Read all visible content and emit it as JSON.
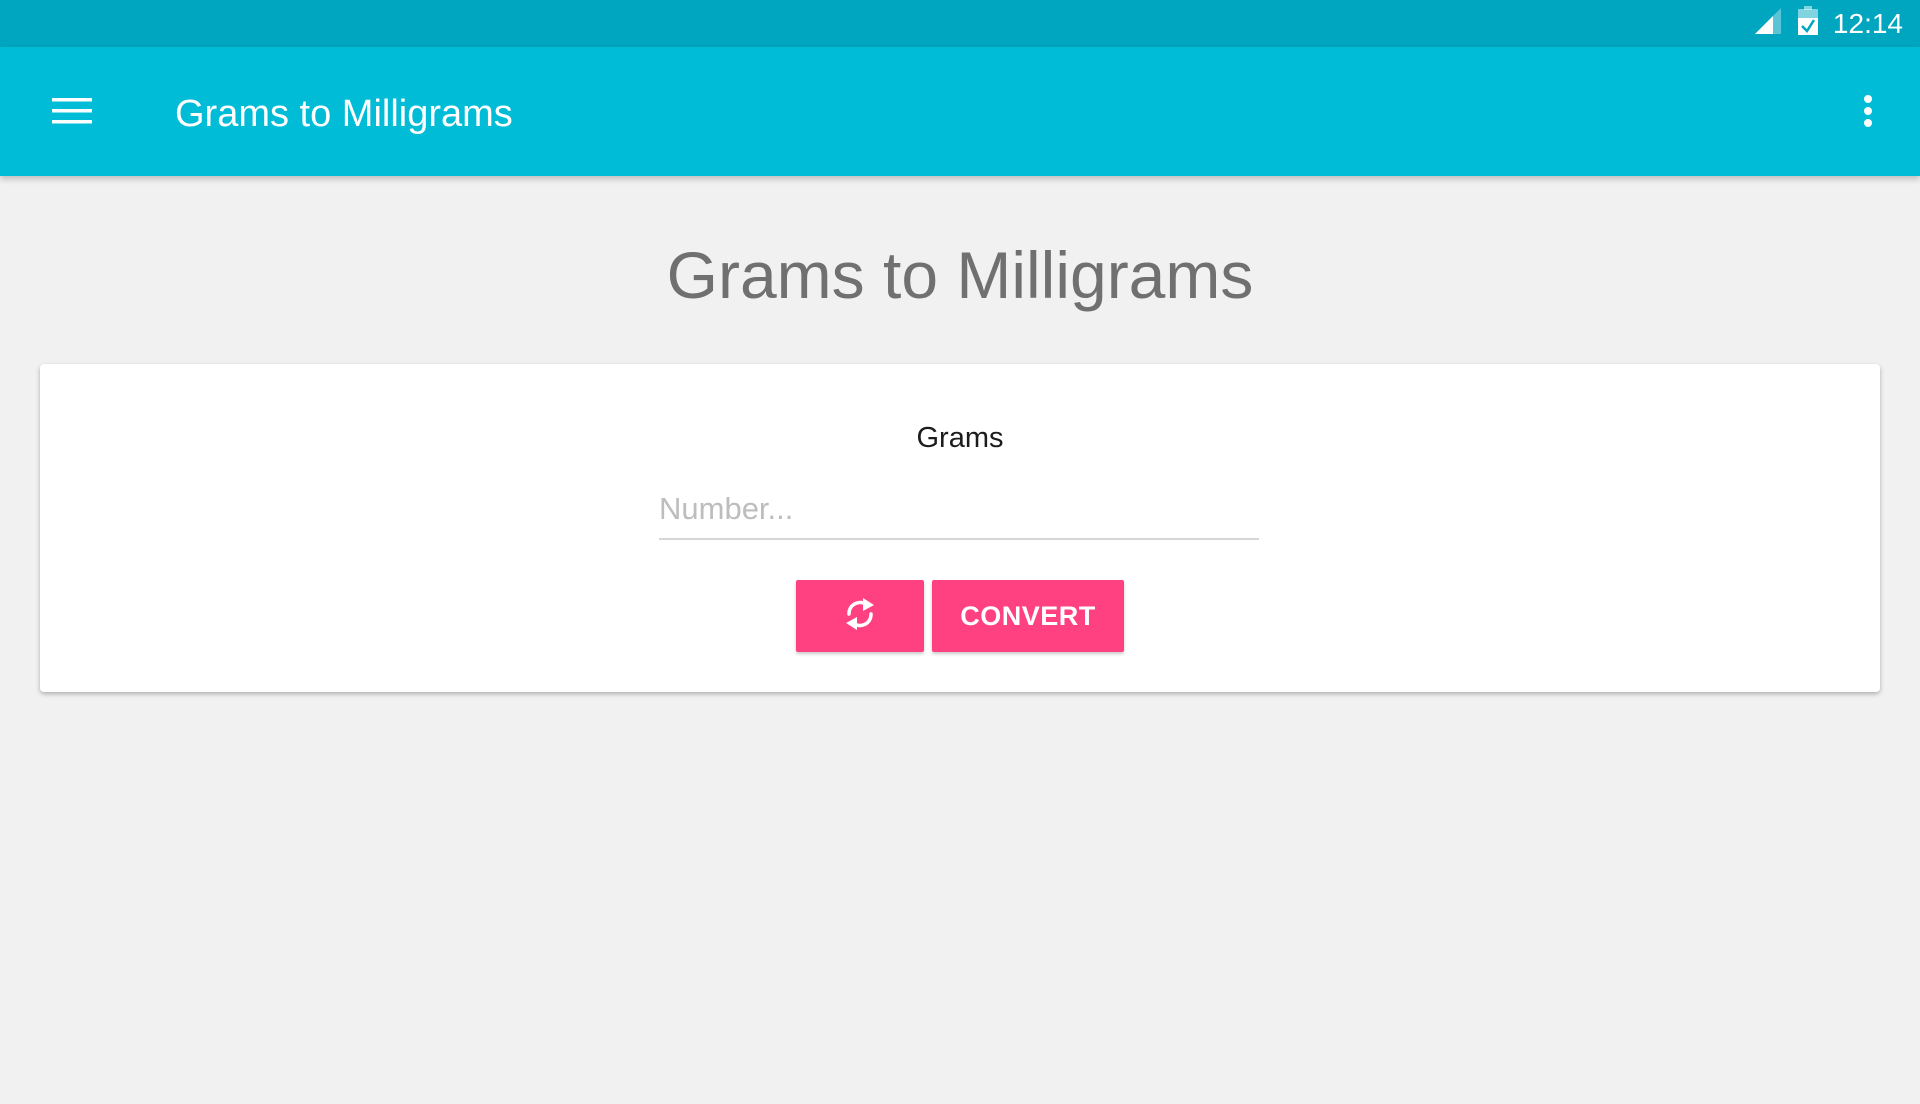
{
  "status_bar": {
    "time": "12:14",
    "icons": [
      "cell-signal-icon",
      "battery-charging-icon"
    ]
  },
  "app_bar": {
    "title": "Grams to Milligrams",
    "nav_icon": "menu-icon",
    "overflow_icon": "more-vert-icon"
  },
  "page": {
    "heading": "Grams to Milligrams"
  },
  "form": {
    "field_label": "Grams",
    "input_value": "",
    "input_placeholder": "Number...",
    "refresh_icon": "refresh-icon",
    "convert_label": "CONVERT"
  },
  "colors": {
    "status_bar": "#00a6c0",
    "app_bar": "#00bcd6",
    "accent": "#ff4081",
    "background": "#f1f1f1"
  }
}
